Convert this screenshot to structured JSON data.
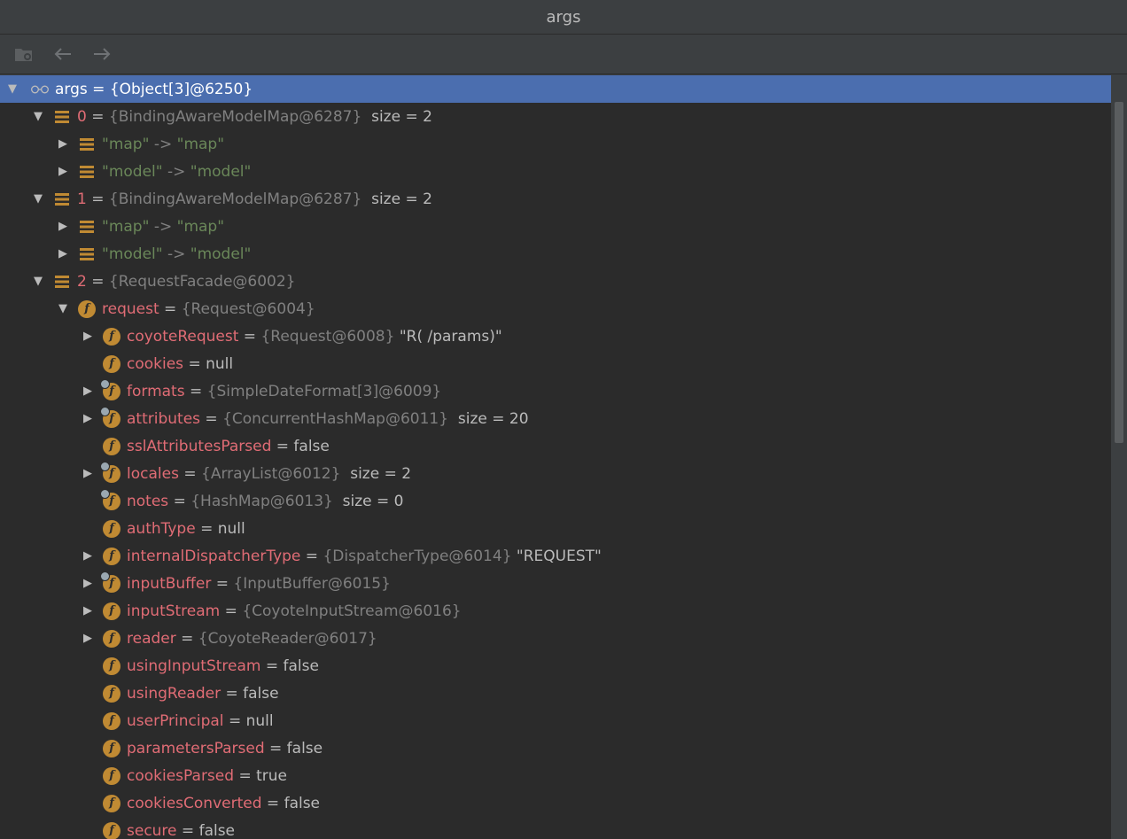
{
  "window": {
    "title": "args"
  },
  "tree": {
    "root": {
      "name": "args",
      "eq": "=",
      "ref": "{Object[3]@6250}"
    },
    "item0": {
      "index": "0",
      "eq": "=",
      "ref": "{BindingAwareModelMap@6287}",
      "extra": "size = 2"
    },
    "item0_children": [
      {
        "key": "\"map\"",
        "arrow": "->",
        "value": "\"map\""
      },
      {
        "key": "\"model\"",
        "arrow": "->",
        "value": "\"model\""
      }
    ],
    "item1": {
      "index": "1",
      "eq": "=",
      "ref": "{BindingAwareModelMap@6287}",
      "extra": "size = 2"
    },
    "item1_children": [
      {
        "key": "\"map\"",
        "arrow": "->",
        "value": "\"map\""
      },
      {
        "key": "\"model\"",
        "arrow": "->",
        "value": "\"model\""
      }
    ],
    "item2": {
      "index": "2",
      "eq": "=",
      "ref": "{RequestFacade@6002}"
    },
    "request": {
      "name": "request",
      "eq": "=",
      "ref": "{Request@6004}"
    },
    "fields": [
      {
        "name": "coyoteRequest",
        "eq": "=",
        "ref": "{Request@6008}",
        "value": "\"R( /params)\""
      },
      {
        "name": "cookies",
        "eq": "=",
        "value": "null"
      },
      {
        "name": "formats",
        "eq": "=",
        "ref": "{SimpleDateFormat[3]@6009}"
      },
      {
        "name": "attributes",
        "eq": "=",
        "ref": "{ConcurrentHashMap@6011}",
        "value": "size = 20"
      },
      {
        "name": "sslAttributesParsed",
        "eq": "=",
        "value": "false"
      },
      {
        "name": "locales",
        "eq": "=",
        "ref": "{ArrayList@6012}",
        "value": "size = 2"
      },
      {
        "name": "notes",
        "eq": "=",
        "ref": "{HashMap@6013}",
        "value": "size = 0"
      },
      {
        "name": "authType",
        "eq": "=",
        "value": "null"
      },
      {
        "name": "internalDispatcherType",
        "eq": "=",
        "ref": "{DispatcherType@6014}",
        "value": "\"REQUEST\""
      },
      {
        "name": "inputBuffer",
        "eq": "=",
        "ref": "{InputBuffer@6015}"
      },
      {
        "name": "inputStream",
        "eq": "=",
        "ref": "{CoyoteInputStream@6016}"
      },
      {
        "name": "reader",
        "eq": "=",
        "ref": "{CoyoteReader@6017}"
      },
      {
        "name": "usingInputStream",
        "eq": "=",
        "value": "false"
      },
      {
        "name": "usingReader",
        "eq": "=",
        "value": "false"
      },
      {
        "name": "userPrincipal",
        "eq": "=",
        "value": "null"
      },
      {
        "name": "parametersParsed",
        "eq": "=",
        "value": "false"
      },
      {
        "name": "cookiesParsed",
        "eq": "=",
        "value": "true"
      },
      {
        "name": "cookiesConverted",
        "eq": "=",
        "value": "false"
      },
      {
        "name": "secure",
        "eq": "=",
        "value": "false"
      }
    ],
    "icon_label": "f"
  }
}
